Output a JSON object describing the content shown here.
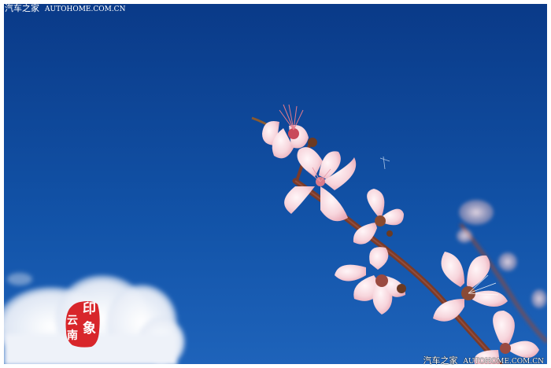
{
  "watermark": {
    "top_cn": "汽车之家",
    "top_en": "AUTOHOME.COM.CN",
    "bottom_cn": "汽车之家",
    "bottom_en": "AUTOHOME.COM.CN"
  },
  "seal": {
    "chars": [
      "印",
      "象",
      "云",
      "南"
    ],
    "color": "#d8262b"
  },
  "colors": {
    "sky_top": "#0b3f8f",
    "sky_bottom": "#1a5db5",
    "blossom": "#f6d6dc",
    "branch": "#7a3b2a"
  }
}
